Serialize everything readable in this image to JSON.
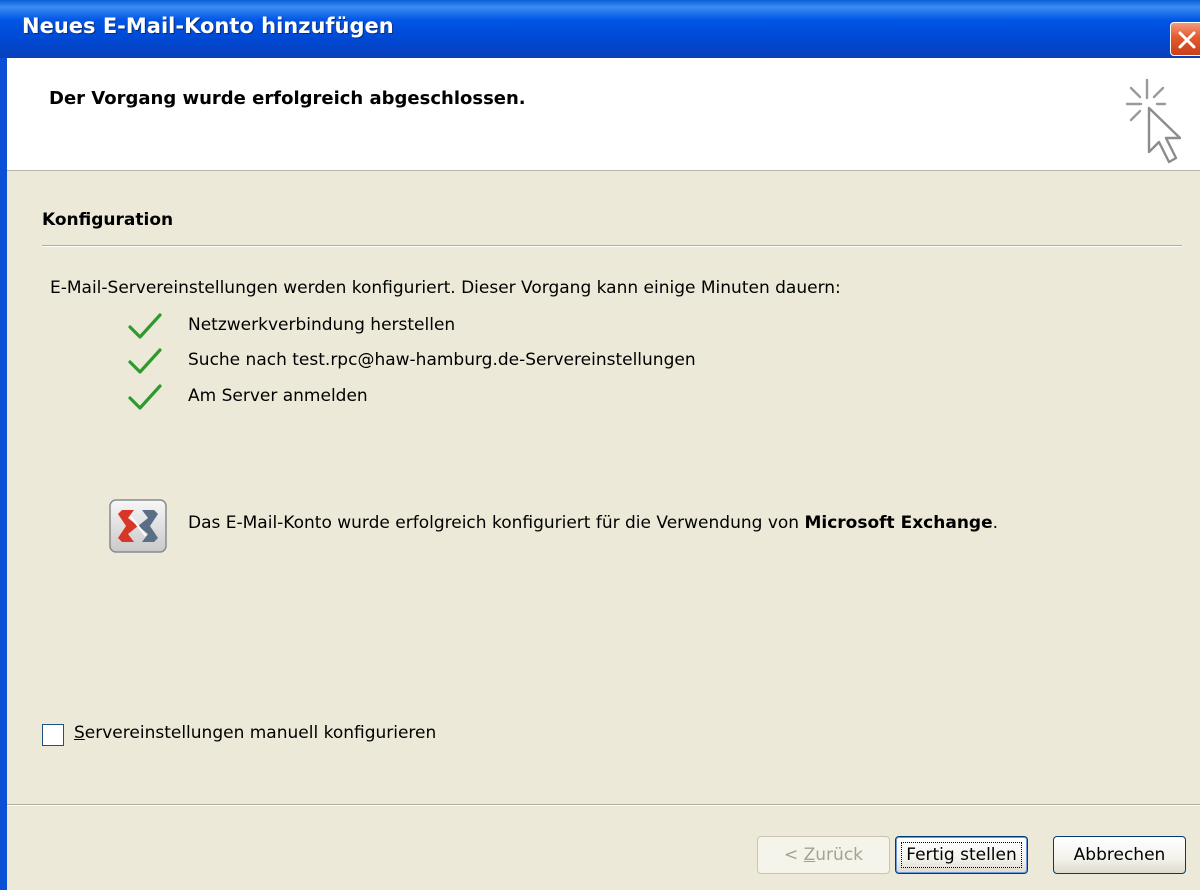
{
  "window": {
    "title": "Neues E-Mail-Konto hinzufügen",
    "close_icon": "close-x"
  },
  "header": {
    "title": "Der Vorgang wurde erfolgreich abgeschlossen.",
    "icon": "sparkle-cursor-icon"
  },
  "section": {
    "title": "Konfiguration",
    "intro": "E-Mail-Servereinstellungen werden konfiguriert. Dieser Vorgang kann einige Minuten dauern:",
    "steps": [
      {
        "label": "Netzwerkverbindung herstellen",
        "status": "done"
      },
      {
        "label": "Suche nach test.rpc@haw-hamburg.de-Servereinstellungen",
        "status": "done"
      },
      {
        "label": "Am Server anmelden",
        "status": "done"
      }
    ]
  },
  "result": {
    "text_prefix": "Das E-Mail-Konto wurde erfolgreich konfiguriert für die Verwendung von ",
    "text_bold": "Microsoft Exchange",
    "text_suffix": ".",
    "icon": "exchange-icon"
  },
  "manual_config": {
    "checked": false,
    "label_accel": "S",
    "label_rest": "ervereinstellungen manuell konfigurieren"
  },
  "buttons": {
    "back_prefix": "< ",
    "back_accel": "Z",
    "back_rest": "urück",
    "finish": "Fertig stellen",
    "cancel": "Abbrechen"
  },
  "colors": {
    "titlebar": "#0055E5",
    "dialog_bg": "#ECE9D8",
    "check_green": "#2E9A2E",
    "close_red": "#E35A2E"
  }
}
